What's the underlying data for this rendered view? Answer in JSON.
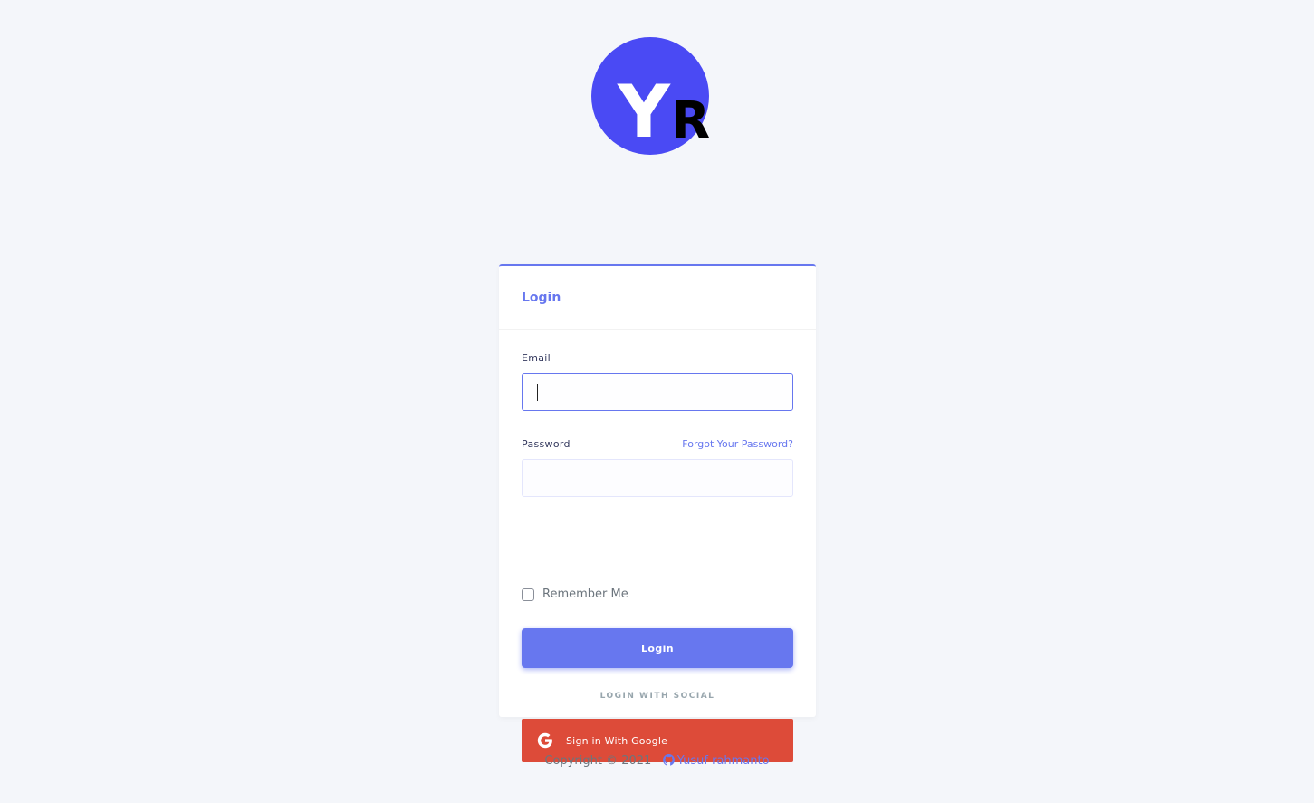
{
  "logo": {
    "text_first": "Y",
    "text_second": "R",
    "circle_color": "#4a4af4"
  },
  "login_card": {
    "title": "Login",
    "email_label": "Email",
    "email_value": "",
    "password_label": "Password",
    "forgot_link": "Forgot Your Password?",
    "password_value": "",
    "remember_label": "Remember Me",
    "remember_checked": false,
    "login_button": "Login",
    "social_heading": "LOGIN WITH SOCIAL",
    "google_button": "Sign in With Google"
  },
  "footer": {
    "copyright": "Copyright © 2021",
    "author_link": "Yusuf rahmanto"
  },
  "icons": {
    "google": "google-icon",
    "github": "github-icon"
  },
  "colors": {
    "primary": "#6777ef",
    "google_red": "#dd4b39",
    "background": "#f4f6fa"
  }
}
